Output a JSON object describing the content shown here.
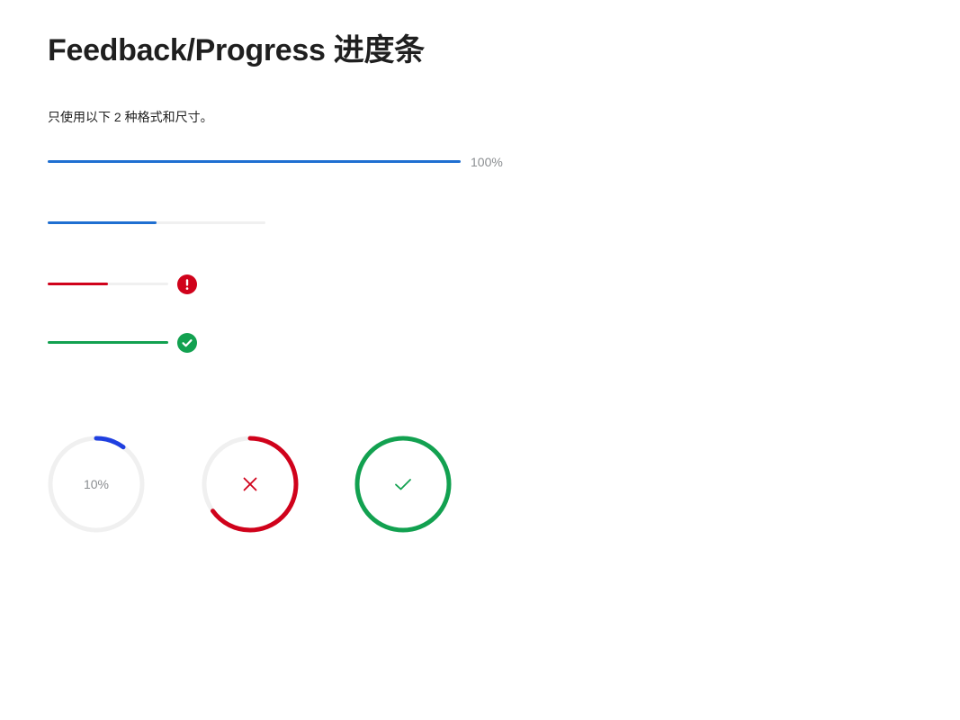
{
  "title": "Feedback/Progress 进度条",
  "description": "只使用以下 2 种格式和尺寸。",
  "colors": {
    "primary": "#1f6fd1",
    "danger": "#d0021b",
    "success": "#12a150",
    "track": "#f0f0f0",
    "circle_primary": "#1f3fe0",
    "muted_text": "#8a8d90"
  },
  "linear_progress": [
    {
      "status": "normal",
      "percent": 100,
      "value_text": "100%"
    },
    {
      "status": "normal",
      "percent": 50
    },
    {
      "status": "error",
      "percent": 50,
      "icon": "exclamation-icon"
    },
    {
      "status": "success",
      "percent": 100,
      "icon": "check-icon"
    }
  ],
  "circular_progress": [
    {
      "status": "normal",
      "percent": 10,
      "center_text": "10%"
    },
    {
      "status": "error",
      "percent": 65,
      "icon": "close-icon"
    },
    {
      "status": "success",
      "percent": 100,
      "icon": "check-icon"
    }
  ]
}
